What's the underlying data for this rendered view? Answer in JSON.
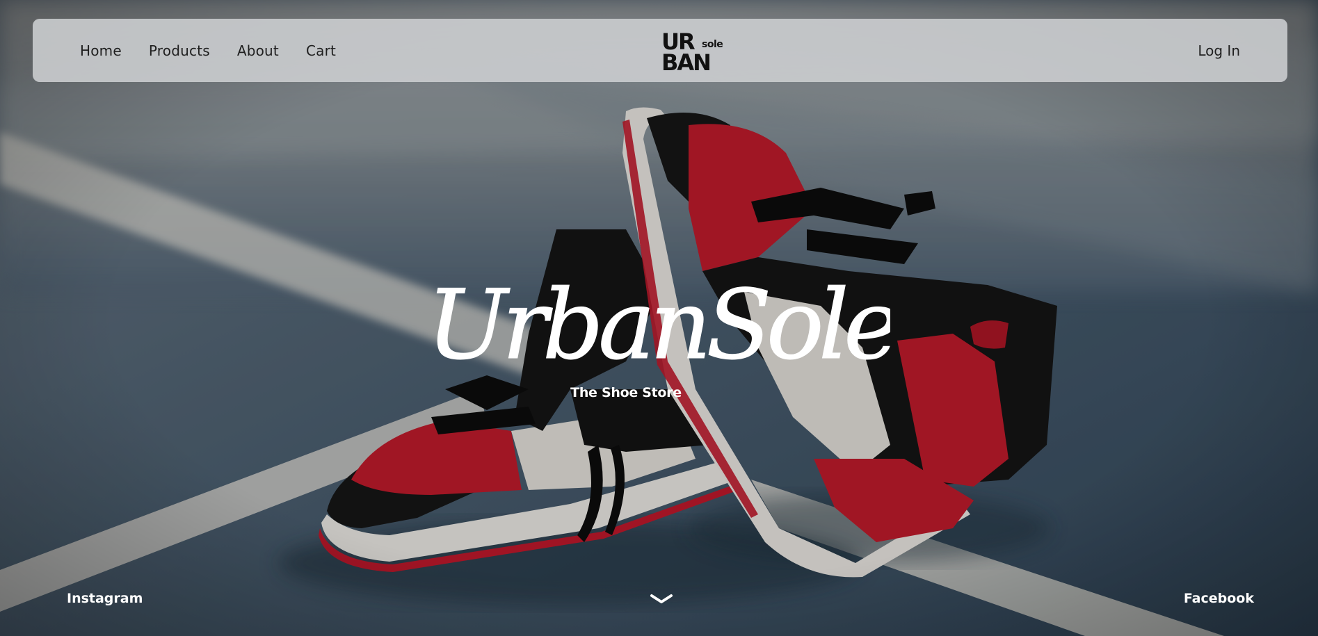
{
  "nav": {
    "links": [
      "Home",
      "Products",
      "About",
      "Cart"
    ],
    "login_label": "Log In",
    "logo": {
      "line1": "UR",
      "line2": "BAN",
      "small": "sole"
    }
  },
  "hero": {
    "title": "UrbanSole",
    "tagline": "The Shoe Store",
    "image": "sneakers-on-court-photo"
  },
  "footer": {
    "social_left": "Instagram",
    "social_right": "Facebook",
    "scroll_icon": "chevron-down-icon"
  },
  "colors": {
    "court_blue": "#4d6273",
    "court_line": "#d8d8d4",
    "shoe_red": "#c4192c",
    "shoe_black": "#151515",
    "nav_bg": "#cdcfd2",
    "text_dark": "#1f1f1f",
    "text_light": "#ffffff"
  }
}
